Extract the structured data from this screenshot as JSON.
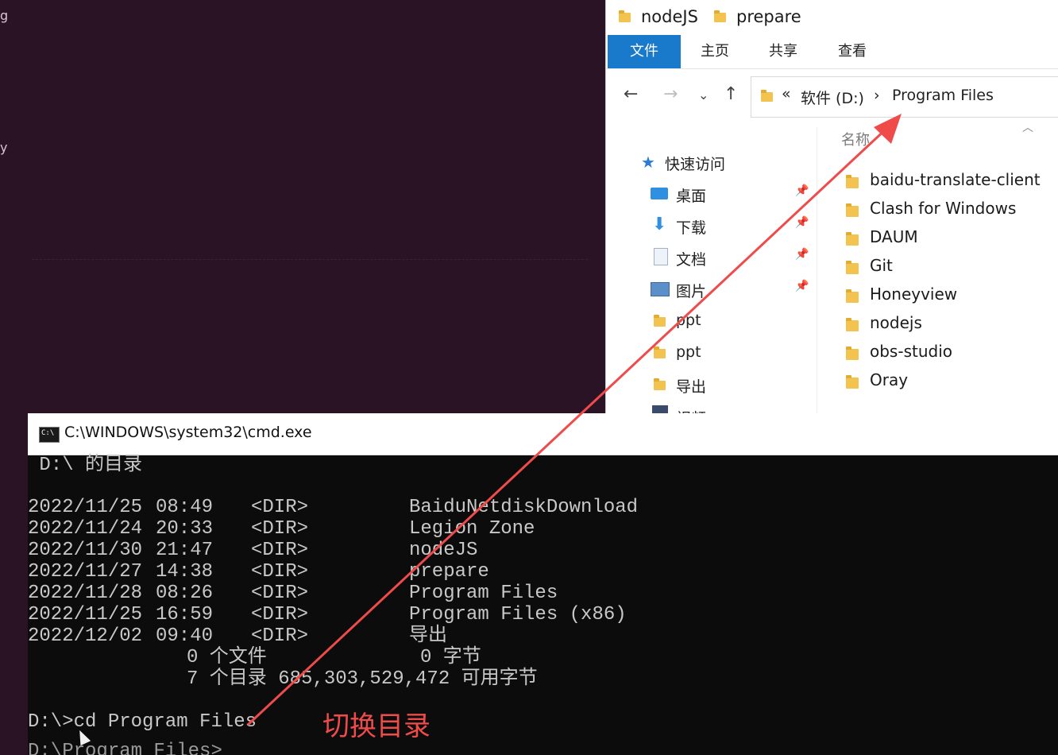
{
  "background": {
    "fragments": [
      "g",
      "y"
    ]
  },
  "explorer": {
    "breadcrumb_title": [
      "nodeJS",
      "prepare"
    ],
    "ribbon_tabs": [
      {
        "label": "文件",
        "active": true
      },
      {
        "label": "主页",
        "active": false
      },
      {
        "label": "共享",
        "active": false
      },
      {
        "label": "查看",
        "active": false
      }
    ],
    "address": {
      "prefix": "«",
      "drive": "软件 (D:)",
      "separator": "›",
      "folder": "Program Files"
    },
    "nav_pane": {
      "quick_access_label": "快速访问",
      "items": [
        {
          "label": "桌面",
          "icon": "desktop-icon",
          "pinned": true
        },
        {
          "label": "下载",
          "icon": "download-icon",
          "pinned": true
        },
        {
          "label": "文档",
          "icon": "document-icon",
          "pinned": true
        },
        {
          "label": "图片",
          "icon": "picture-icon",
          "pinned": true
        },
        {
          "label": "ppt",
          "icon": "folder-icon",
          "pinned": false
        },
        {
          "label": "ppt",
          "icon": "folder-icon",
          "pinned": false
        },
        {
          "label": "导出",
          "icon": "folder-icon",
          "pinned": false
        },
        {
          "label": "视频",
          "icon": "video-icon",
          "pinned": false
        }
      ]
    },
    "file_list": {
      "column_name": "名称",
      "items": [
        "baidu-translate-client",
        "Clash for Windows",
        "DAUM",
        "Git",
        "Honeyview",
        "nodejs",
        "obs-studio",
        "Oray"
      ]
    },
    "colors": {
      "accent": "#1979ca",
      "folder": "#f2c44f"
    }
  },
  "cmd": {
    "title": "C:\\WINDOWS\\system32\\cmd.exe",
    "header_line": " D:\\ 的目录",
    "entries": [
      {
        "date": "2022/11/25",
        "time": "08:49",
        "type": "<DIR>",
        "name": "BaiduNetdiskDownload"
      },
      {
        "date": "2022/11/24",
        "time": "20:33",
        "type": "<DIR>",
        "name": "Legion Zone"
      },
      {
        "date": "2022/11/30",
        "time": "21:47",
        "type": "<DIR>",
        "name": "nodeJS"
      },
      {
        "date": "2022/11/27",
        "time": "14:38",
        "type": "<DIR>",
        "name": "prepare"
      },
      {
        "date": "2022/11/28",
        "time": "08:26",
        "type": "<DIR>",
        "name": "Program Files"
      },
      {
        "date": "2022/11/25",
        "time": "16:59",
        "type": "<DIR>",
        "name": "Program Files (x86)"
      },
      {
        "date": "2022/12/02",
        "time": "09:40",
        "type": "<DIR>",
        "name": "导出"
      }
    ],
    "summary_files": "0 个文件",
    "summary_files_bytes": "0 字节",
    "summary_dirs": "7 个目录 685,303,529,472 可用字节",
    "prompt_line": "D:\\>cd Program Files",
    "next_line_partial": "D:\\Program Files>"
  },
  "annotation": {
    "label": "切换目录",
    "color": "#ef4b4b"
  }
}
